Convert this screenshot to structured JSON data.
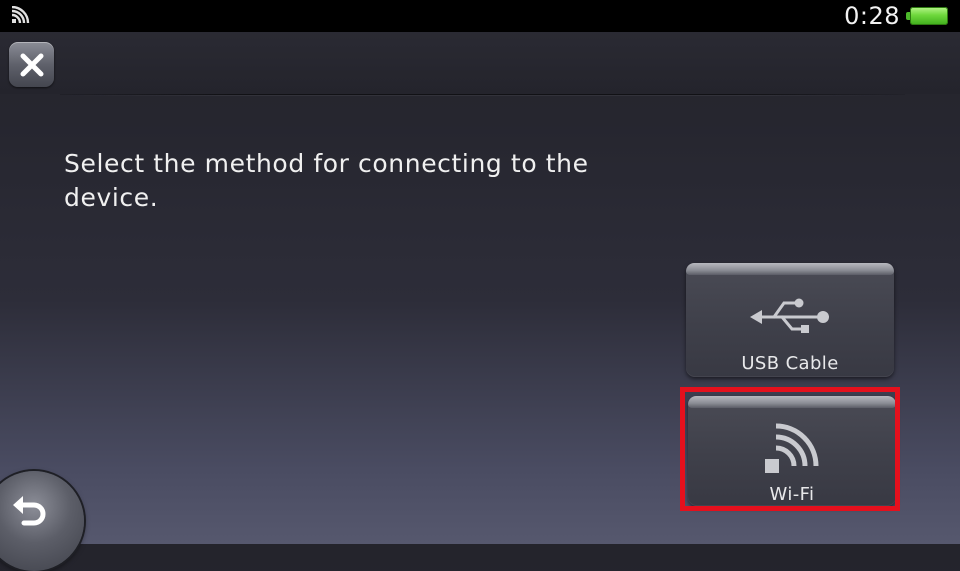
{
  "status_bar": {
    "wifi_icon": "wifi-signal-icon",
    "time": "0:28",
    "battery_icon": "battery-full-icon",
    "battery_color": "#6fd83c"
  },
  "header": {
    "close_icon": "close-icon"
  },
  "main": {
    "instruction": "Select the method for connecting to the device."
  },
  "options": [
    {
      "label": "USB Cable",
      "icon": "usb-icon",
      "selected": false
    },
    {
      "label": "Wi-Fi",
      "icon": "wifi-icon",
      "selected": true
    }
  ],
  "footer": {
    "back_icon": "back-arrow-icon"
  },
  "colors": {
    "highlight": "#e5101d",
    "background": "#2d2d39"
  }
}
